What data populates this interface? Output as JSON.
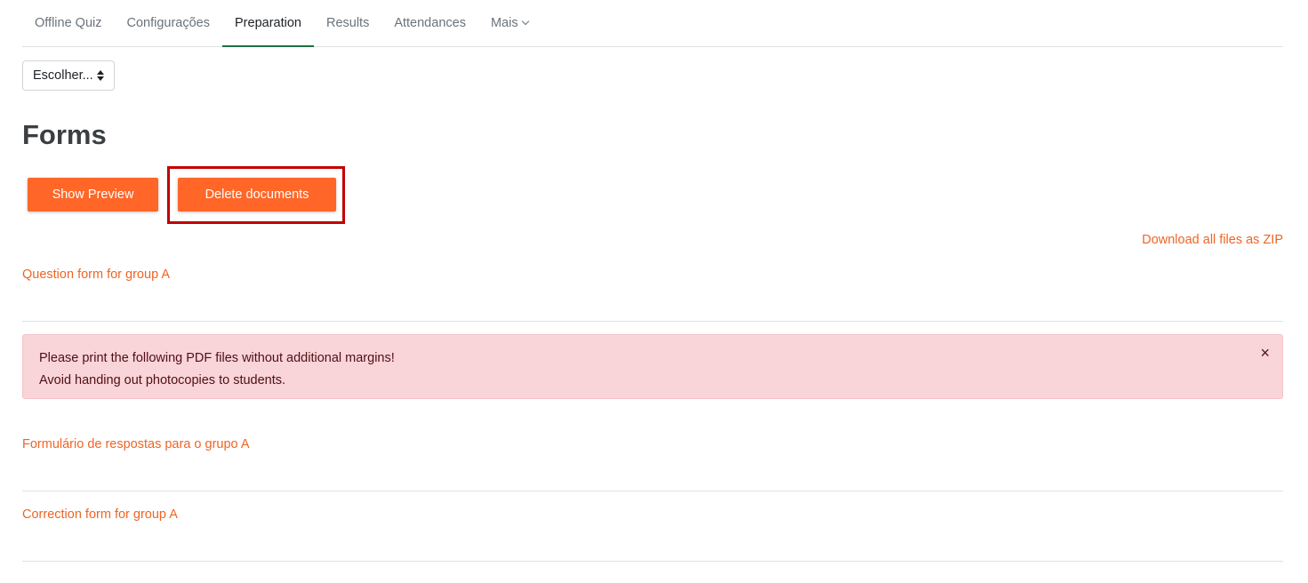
{
  "tabs": [
    {
      "label": "Offline Quiz"
    },
    {
      "label": "Configurações"
    },
    {
      "label": "Preparation"
    },
    {
      "label": "Results"
    },
    {
      "label": "Attendances"
    },
    {
      "label": "Mais"
    }
  ],
  "active_tab": "Preparation",
  "select": {
    "value": "Escolher..."
  },
  "page_title": "Forms",
  "buttons": {
    "show_preview": "Show Preview",
    "delete_documents": "Delete documents"
  },
  "download_zip": "Download all files as ZIP",
  "question_form": "Question form for group A",
  "alert": {
    "line1": "Please print the following PDF files without additional margins!",
    "line2": "Avoid handing out photocopies to students.",
    "close": "×"
  },
  "answer_form": "Formulário de respostas para o grupo A",
  "correction_form": "Correction form for group A",
  "colors": {
    "accent": "#ff6627",
    "link": "#f06424",
    "active_tab": "#1f6e43",
    "highlight": "#c00000",
    "alert_bg": "#f9d5d9"
  }
}
